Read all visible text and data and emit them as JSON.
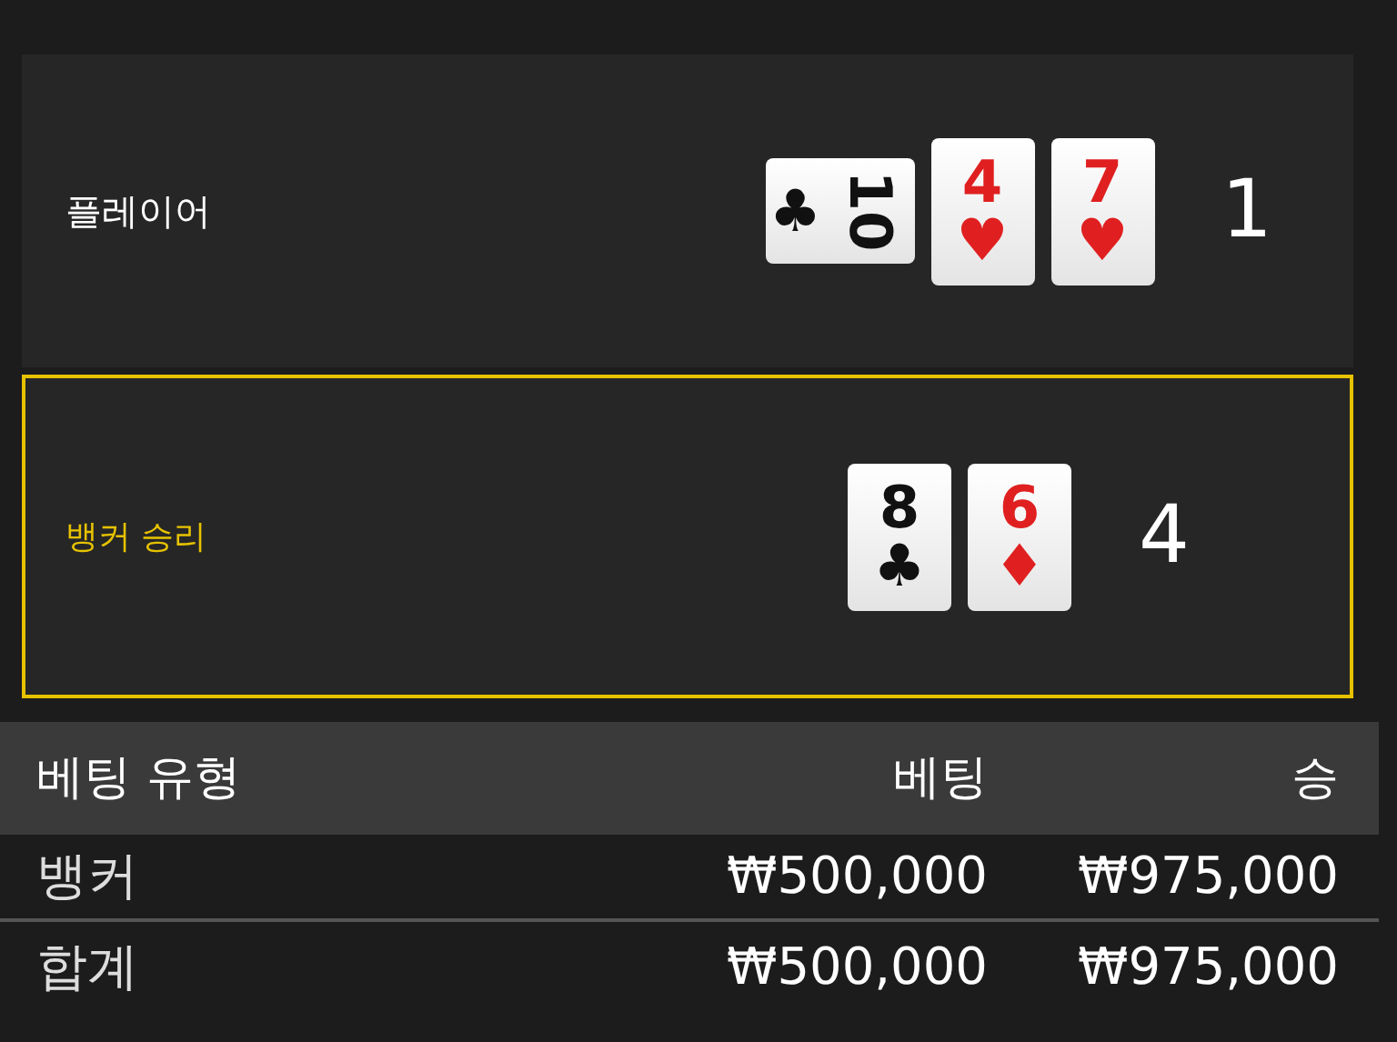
{
  "hands": [
    {
      "label": "플레이어",
      "winner": false,
      "score": "1",
      "cards": [
        {
          "rank": "10",
          "suit": "♣",
          "color": "#111111",
          "rotated": true
        },
        {
          "rank": "4",
          "suit": "♥",
          "color": "#e02020",
          "rotated": false
        },
        {
          "rank": "7",
          "suit": "♥",
          "color": "#e02020",
          "rotated": false
        }
      ]
    },
    {
      "label": "뱅커 승리",
      "winner": true,
      "score": "4",
      "cards": [
        {
          "rank": "8",
          "suit": "♣",
          "color": "#111111",
          "rotated": false
        },
        {
          "rank": "6",
          "suit": "♦",
          "color": "#e02020",
          "rotated": false
        }
      ]
    }
  ],
  "bets": {
    "columns": [
      "베팅 유형",
      "베팅",
      "승"
    ],
    "rows": [
      [
        "뱅커",
        "₩500,000",
        "₩975,000"
      ]
    ],
    "total": [
      "합계",
      "₩500,000",
      "₩975,000"
    ]
  }
}
